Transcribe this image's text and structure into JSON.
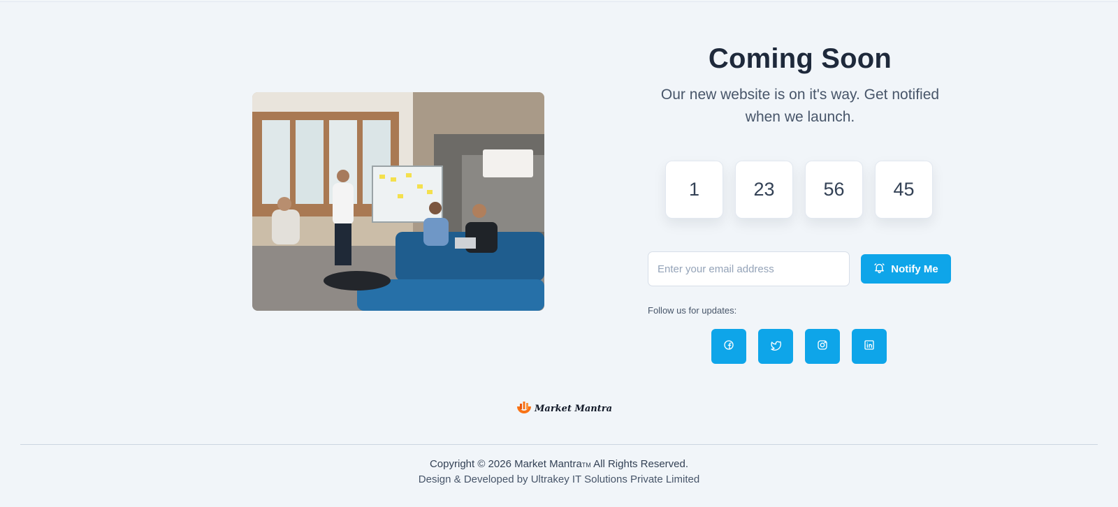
{
  "hero": {
    "title": "Coming Soon",
    "subtitle": "Our new website is on it's way. Get notified when we launch."
  },
  "countdown": [
    "1",
    "23",
    "56",
    "45"
  ],
  "signup": {
    "email_placeholder": "Enter your email address",
    "notify_label": "Notify Me"
  },
  "social": {
    "heading": "Follow us for updates:",
    "icons": [
      "facebook-icon",
      "twitter-icon",
      "instagram-icon",
      "linkedin-icon"
    ]
  },
  "footer": {
    "logo_text": "Market Mantra",
    "copyright": "Copyright © 2026 Market Mantra",
    "trademark": "TM",
    "rights": " All Rights Reserved.",
    "credit": "Design & Developed by Ultrakey IT Solutions Private Limited"
  },
  "colors": {
    "accent": "#0ea5e9",
    "background": "#f1f5f9",
    "heading": "#1e293b",
    "logo_orange": "#f97316"
  }
}
